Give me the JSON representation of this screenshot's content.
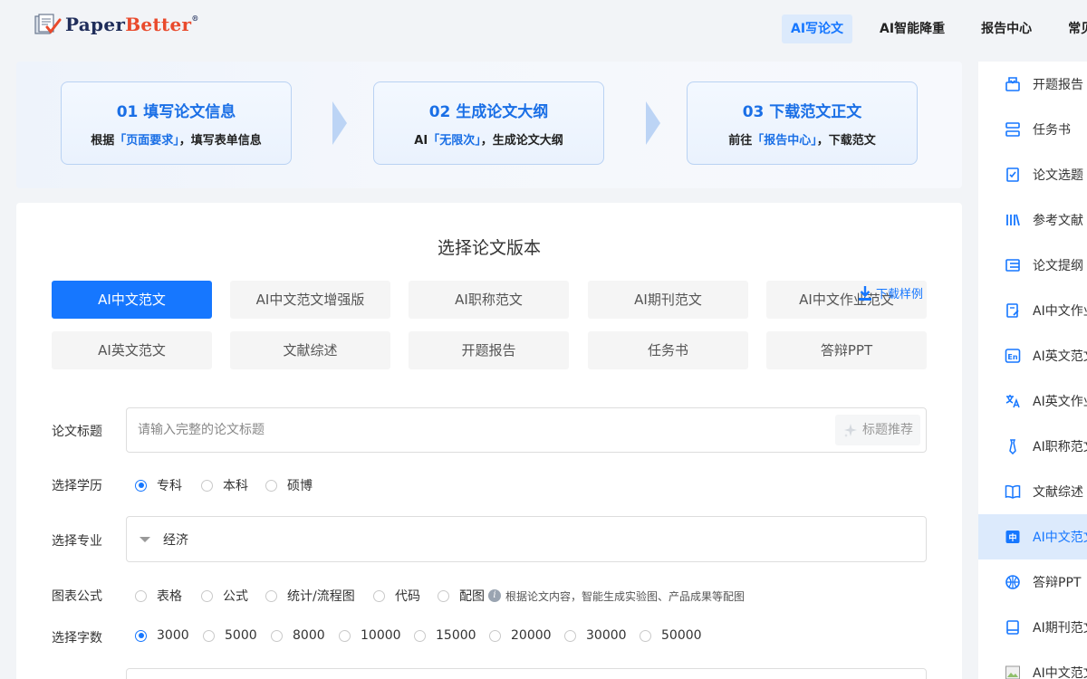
{
  "header": {
    "logo_paper": "Paper",
    "logo_better": "Better",
    "logo_reg": "®",
    "nav": [
      {
        "label": "AI写论文",
        "active": true
      },
      {
        "label": "AI智能降重",
        "active": false
      },
      {
        "label": "报告中心",
        "active": false
      },
      {
        "label": "常见",
        "active": false
      }
    ]
  },
  "steps": [
    {
      "title": "01  填写论文信息",
      "desc_pre": "根据",
      "desc_hl": "「页面要求」",
      "desc_post": "，填写表单信息"
    },
    {
      "title": "02  生成论文大纲",
      "desc_pre": "AI",
      "desc_hl": "「无限次」",
      "desc_post": "，生成论文大纲"
    },
    {
      "title": "03  下载范文正文",
      "desc_pre": "前往",
      "desc_hl": "「报告中心」",
      "desc_post": "，下载范文"
    }
  ],
  "main": {
    "title": "选择论文版本",
    "download_sample": "下载样例",
    "versions": [
      {
        "label": "AI中文范文",
        "active": true
      },
      {
        "label": "AI中文范文增强版",
        "active": false
      },
      {
        "label": "AI职称范文",
        "active": false
      },
      {
        "label": "AI期刊范文",
        "active": false
      },
      {
        "label": "AI中文作业范文",
        "active": false
      },
      {
        "label": "AI英文范文",
        "active": false
      },
      {
        "label": "文献综述",
        "active": false
      },
      {
        "label": "开题报告",
        "active": false
      },
      {
        "label": "任务书",
        "active": false
      },
      {
        "label": "答辩PPT",
        "active": false
      }
    ],
    "title_field": {
      "label": "论文标题",
      "placeholder": "请输入完整的论文标题",
      "suggest": "标题推荐"
    },
    "education": {
      "label": "选择学历",
      "options": [
        "专科",
        "本科",
        "硕博"
      ],
      "selected": "专科"
    },
    "major": {
      "label": "选择专业",
      "value": "经济"
    },
    "charts": {
      "label": "图表公式",
      "options": [
        "表格",
        "公式",
        "统计/流程图",
        "代码",
        "配图"
      ],
      "hint": "根据论文内容，智能生成实验图、产品成果等配图"
    },
    "wordcount": {
      "label": "选择字数",
      "options": [
        "3000",
        "5000",
        "8000",
        "10000",
        "15000",
        "20000",
        "30000",
        "50000"
      ],
      "selected": "3000"
    }
  },
  "sidebar": {
    "items": [
      {
        "label": "开题报告",
        "icon": "open-report-icon",
        "active": false
      },
      {
        "label": "任务书",
        "icon": "task-book-icon",
        "active": false
      },
      {
        "label": "论文选题",
        "icon": "topic-icon",
        "active": false
      },
      {
        "label": "参考文献",
        "icon": "references-icon",
        "active": false
      },
      {
        "label": "论文提纲",
        "icon": "outline-icon",
        "active": false
      },
      {
        "label": "AI中文作业",
        "icon": "homework-icon",
        "active": false
      },
      {
        "label": "AI英文范文",
        "icon": "english-icon",
        "active": false
      },
      {
        "label": "AI英文作业",
        "icon": "translate-icon",
        "active": false
      },
      {
        "label": "AI职称范文",
        "icon": "tie-icon",
        "active": false
      },
      {
        "label": "文献综述",
        "icon": "book-icon",
        "active": false
      },
      {
        "label": "AI中文范文",
        "icon": "chinese-icon",
        "active": true
      },
      {
        "label": "答辩PPT",
        "icon": "ppt-icon",
        "active": false
      },
      {
        "label": "AI期刊范文",
        "icon": "journal-icon",
        "active": false
      },
      {
        "label": "AI中文范文",
        "icon": "image-icon",
        "active": false
      }
    ]
  },
  "colors": {
    "accent": "#1677ff",
    "active_bg": "#dceafc"
  }
}
